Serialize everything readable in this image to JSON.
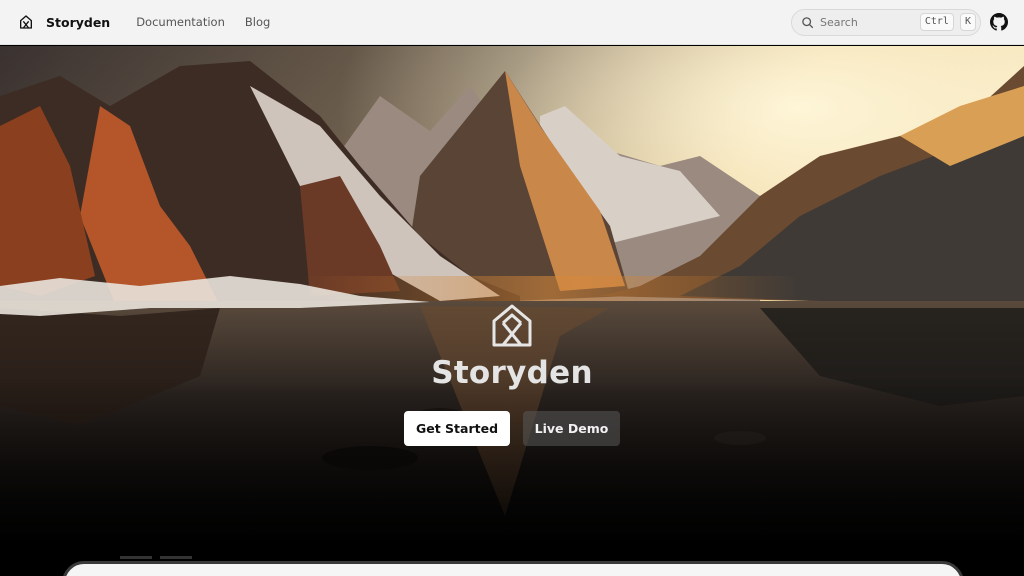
{
  "header": {
    "brand": "Storyden",
    "nav": [
      {
        "label": "Documentation"
      },
      {
        "label": "Blog"
      }
    ],
    "search": {
      "label": "Search",
      "shortcut_modifier": "Ctrl",
      "shortcut_key": "K"
    }
  },
  "hero": {
    "title": "Storyden",
    "primary_cta": "Get Started",
    "secondary_cta": "Live Demo"
  },
  "icons": {
    "brand": "storyden-logo-icon",
    "search": "search-icon",
    "github": "github-icon"
  },
  "colors": {
    "header_bg": "#f3f3f3",
    "primary_button": "#ffffff",
    "secondary_button": "#5a5a5a"
  }
}
